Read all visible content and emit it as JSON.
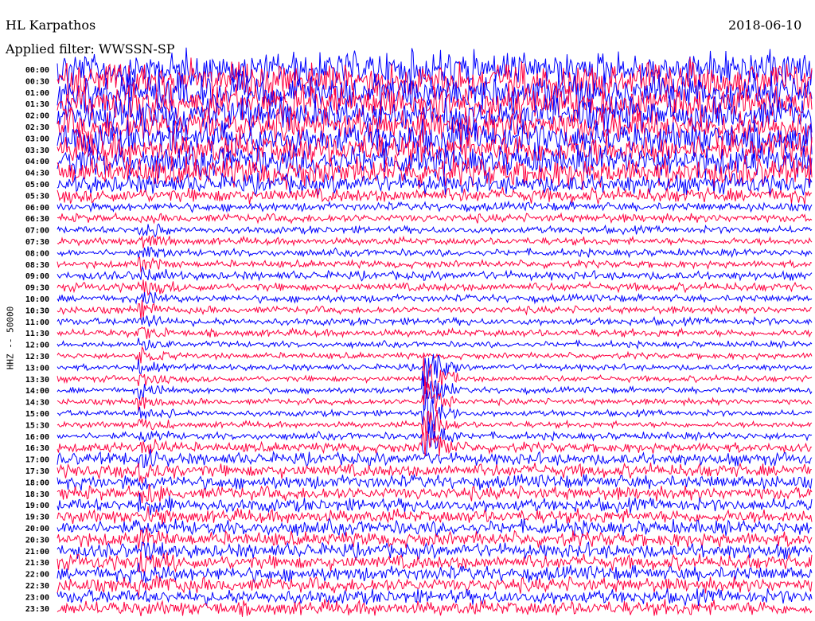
{
  "header": {
    "station": "HL Karpathos",
    "date": "2018-06-10",
    "filter": "Applied filter: WWSSN-SP"
  },
  "channel_label": "HHZ -- 50000",
  "chart_data": {
    "type": "line",
    "title": "HL Karpathos 2018-06-10",
    "ylabel": "HHZ -- 50000",
    "row_labels": [
      "00:00",
      "00:30",
      "01:00",
      "01:30",
      "02:00",
      "02:30",
      "03:00",
      "03:30",
      "04:00",
      "04:30",
      "05:00",
      "05:30",
      "06:00",
      "06:30",
      "07:00",
      "07:30",
      "08:00",
      "08:30",
      "09:00",
      "09:30",
      "10:00",
      "10:30",
      "11:00",
      "11:30",
      "12:00",
      "12:30",
      "13:00",
      "13:30",
      "14:00",
      "14:30",
      "15:00",
      "15:30",
      "16:00",
      "16:30",
      "17:00",
      "17:30",
      "18:00",
      "18:30",
      "19:00",
      "19:30",
      "20:00",
      "20:30",
      "21:00",
      "21:30",
      "22:00",
      "22:30",
      "23:00",
      "23:30"
    ],
    "relative_noise_level": [
      30,
      30,
      30,
      30,
      28,
      28,
      28,
      26,
      26,
      24,
      16,
      12,
      7,
      7,
      6,
      6,
      6,
      6,
      7,
      7,
      6,
      6,
      6,
      6,
      5,
      5,
      5,
      5,
      5,
      5,
      5,
      5,
      6,
      8,
      10,
      11,
      11,
      11,
      11,
      11,
      12,
      12,
      12,
      12,
      12,
      12,
      12,
      12
    ],
    "events": [
      {
        "minute_offset": 3.2,
        "rows": [
          14,
          45
        ],
        "amplitude": 12
      },
      {
        "minute_offset": 14.5,
        "rows": [
          26,
          33
        ],
        "amplitude": 40
      }
    ],
    "series_colors": [
      "#0000ff",
      "#ff0040"
    ]
  }
}
